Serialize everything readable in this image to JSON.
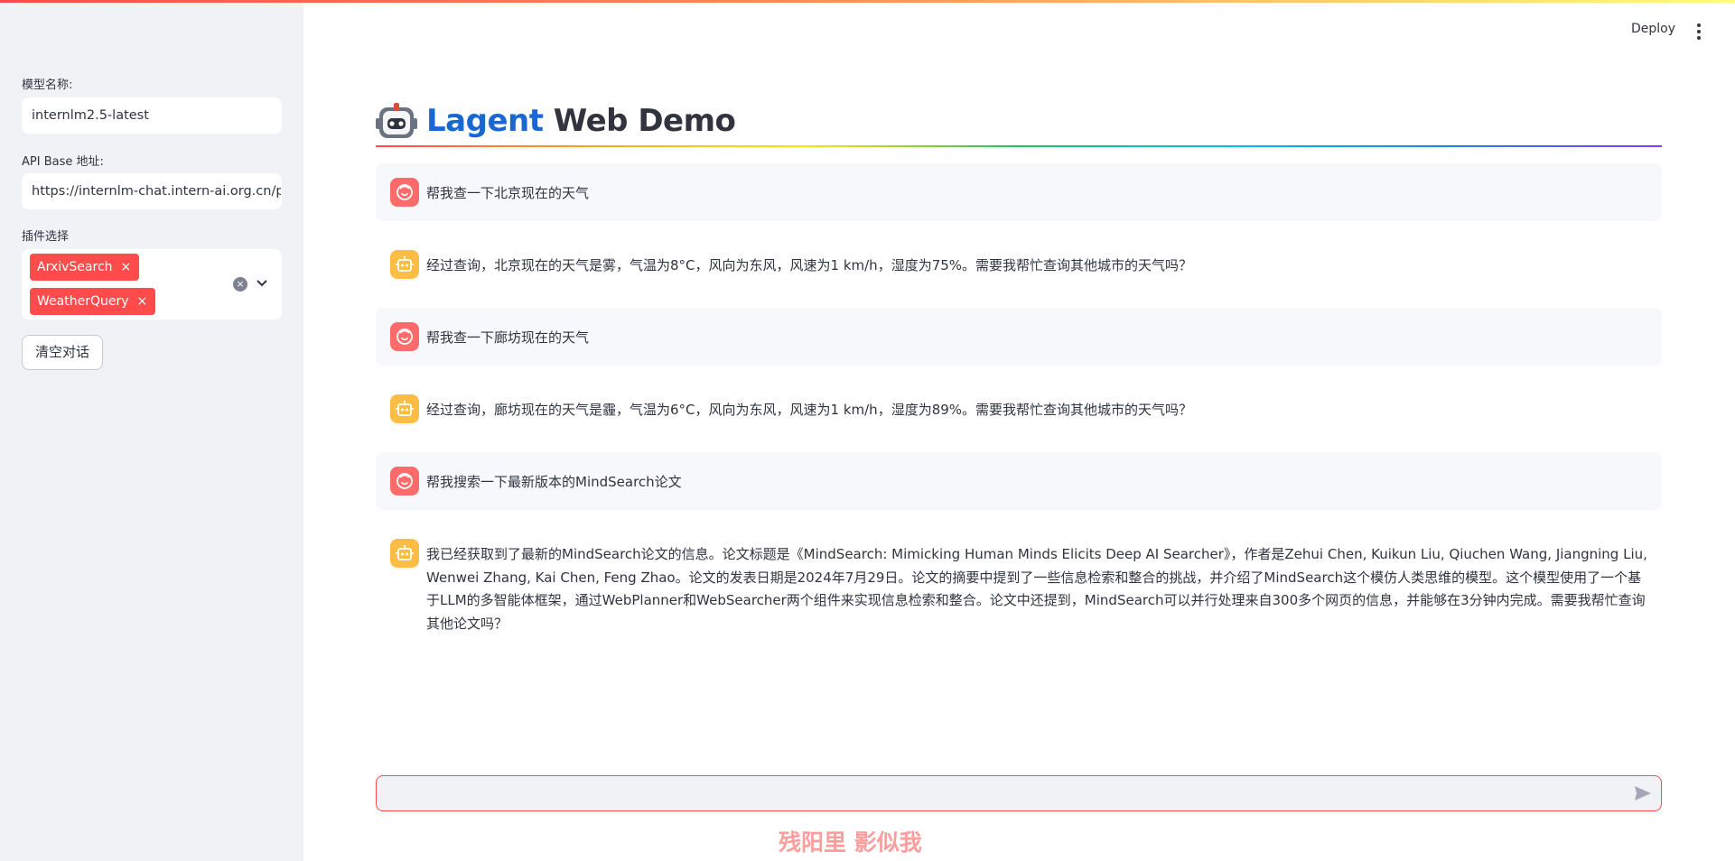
{
  "header": {
    "deploy_label": "Deploy",
    "menu_icon": "kebab-menu-icon"
  },
  "sidebar": {
    "model_label": "模型名称:",
    "model_value": "internlm2.5-latest",
    "api_label": "API Base 地址:",
    "api_value": "https://internlm-chat.intern-ai.org.cn/pu",
    "plugins_label": "插件选择",
    "plugins": [
      {
        "label": "ArxivSearch",
        "remove": "×"
      },
      {
        "label": "WeatherQuery",
        "remove": "×"
      }
    ],
    "clear_label": "清空对话"
  },
  "main": {
    "title_accent": "Lagent",
    "title_rest": " Web Demo"
  },
  "messages": [
    {
      "role": "user",
      "text": "帮我查一下北京现在的天气"
    },
    {
      "role": "assistant",
      "text": "经过查询，北京现在的天气是雾，气温为8°C，风向为东风，风速为1 km/h，湿度为75%。需要我帮忙查询其他城市的天气吗？"
    },
    {
      "role": "user",
      "text": "帮我查一下廊坊现在的天气"
    },
    {
      "role": "assistant",
      "text": "经过查询，廊坊现在的天气是霾，气温为6°C，风向为东风，风速为1 km/h，湿度为89%。需要我帮忙查询其他城市的天气吗？"
    },
    {
      "role": "user",
      "text": "帮我搜索一下最新版本的MindSearch论文"
    },
    {
      "role": "assistant",
      "text": "我已经获取到了最新的MindSearch论文的信息。论文标题是《MindSearch: Mimicking Human Minds Elicits Deep AI Searcher》，作者是Zehui Chen, Kuikun Liu, Qiuchen Wang, Jiangning Liu, Wenwei Zhang, Kai Chen, Feng Zhao。论文的发表日期是2024年7月29日。论文的摘要中提到了一些信息检索和整合的挑战，并介绍了MindSearch这个模仿人类思维的模型。这个模型使用了一个基于LLM的多智能体框架，通过WebPlanner和WebSearcher两个组件来实现信息检索和整合。论文中还提到，MindSearch可以并行处理来自300多个网页的信息，并能够在3分钟内完成。需要我帮忙查询其他论文吗？"
    }
  ],
  "chat_input": {
    "value": "",
    "placeholder": ""
  },
  "watermark": "残阳里 影似我",
  "colors": {
    "accent": "#ff4b4b",
    "title_blue": "#1967d2",
    "user_avatar": "#ff6b6b",
    "assistant_avatar": "#ffbd45"
  }
}
